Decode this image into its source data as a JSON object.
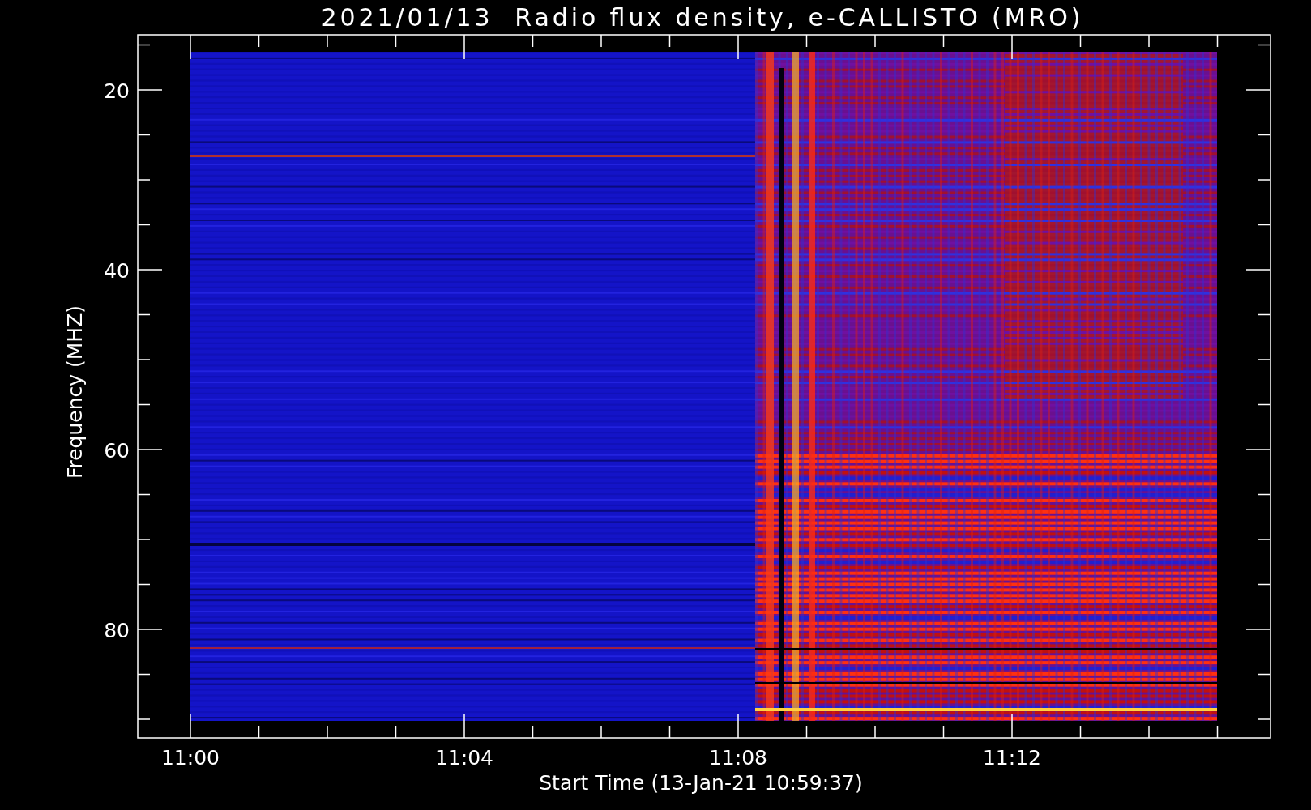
{
  "title": "2021/01/13  Radio flux density, e-CALLISTO (MRO)",
  "y_axis": {
    "label": "Frequency (MHZ)",
    "ticks": [
      "20",
      "40",
      "60",
      "80"
    ]
  },
  "x_axis": {
    "label": "Start Time (13-Jan-21 10:59:37)",
    "ticks": [
      "11:00",
      "11:04",
      "11:08",
      "11:12"
    ]
  }
}
